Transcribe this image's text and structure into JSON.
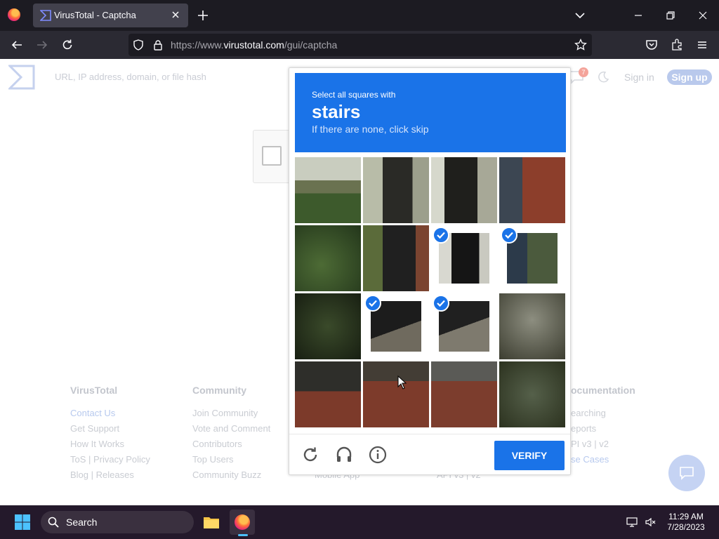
{
  "browser": {
    "tab_title": "VirusTotal - Captcha",
    "url_prefix": "https://www.",
    "url_domain": "virustotal.com",
    "url_path": "/gui/captcha"
  },
  "site": {
    "search_placeholder": "URL, IP address, domain, or file hash",
    "notif_count": "7",
    "sign_in": "Sign in",
    "sign_up": "Sign up"
  },
  "footer": {
    "columns": [
      {
        "heading": "VirusTotal",
        "links": [
          "Contact Us",
          "Get Support",
          "How It Works",
          "ToS | Privacy Policy",
          "Blog | Releases"
        ]
      },
      {
        "heading": "Community",
        "links": [
          "Join Community",
          "Vote and Comment",
          "Contributors",
          "Top Users",
          "Community Buzz"
        ]
      },
      {
        "heading": "",
        "links": [
          "Mobile App"
        ]
      },
      {
        "heading": "",
        "links": [
          "API v3 | v2"
        ]
      },
      {
        "heading": "ocumentation",
        "links": [
          "earching",
          "eports",
          "PI v3 | v2",
          "se Cases"
        ]
      }
    ]
  },
  "captcha": {
    "prompt_line1": "Select all squares with",
    "prompt_word": "stairs",
    "prompt_line3": "If there are none, click skip",
    "tiles_selected": [
      [
        false,
        false,
        false,
        false
      ],
      [
        false,
        false,
        true,
        true
      ],
      [
        false,
        true,
        true,
        false
      ],
      [
        false,
        false,
        false,
        false
      ]
    ],
    "verify_label": "VERIFY"
  },
  "taskbar": {
    "search_label": "Search",
    "time": "11:29 AM",
    "date": "7/28/2023"
  },
  "colors": {
    "accent": "#1a73e8",
    "tab_bar": "#1c1b22",
    "nav_bar": "#2b2a33",
    "taskbar": "#24192b"
  }
}
